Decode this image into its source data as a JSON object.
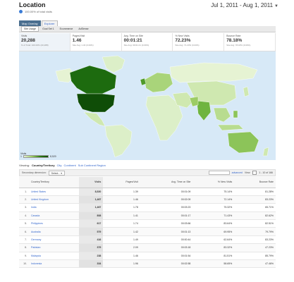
{
  "header": {
    "title": "Location",
    "date_range": "Jul 1, 2011 - Aug 1, 2011",
    "subtitle": "100.00% of total visits"
  },
  "view_tabs": [
    "Map Overlay",
    "Explorer"
  ],
  "sub_tabs": [
    "Site Usage",
    "Goal Set 1",
    "Ecommerce",
    "AdSense"
  ],
  "metrics": [
    {
      "label": "Visits",
      "value": "20,288",
      "sub": "% of Total: 100.00% (20,288)"
    },
    {
      "label": "Pages/Visit",
      "value": "1.46",
      "sub": "Site Avg: 1.46 (0.00%)"
    },
    {
      "label": "Avg. Time on Site",
      "value": "00:01:21",
      "sub": "Site Avg: 00:01:21 (0.00%)"
    },
    {
      "label": "% New Visits",
      "value": "72.23%",
      "sub": "Site Avg: 71.23% (0.00%)"
    },
    {
      "label": "Bounce Rate",
      "value": "78.18%",
      "sub": "Site Avg: 78.18% (0.00%)"
    }
  ],
  "map_legend": {
    "label": "Visits",
    "min": "1",
    "max": "8,520"
  },
  "map_colors": {
    "ocean": "#d7e9f7",
    "low": "#e6f3d3",
    "mid": "#9ccc65",
    "high": "#1d6b0f",
    "top": "#0f4d07"
  },
  "viewing": {
    "prefix": "Viewing:",
    "links": [
      "Country/Territory",
      "City",
      "Continent",
      "Sub Continent Region"
    ]
  },
  "toolbar": {
    "secondary_dimension": "Secondary dimension:",
    "select_label": "Select...",
    "advanced": "advanced",
    "view": "View:",
    "pager": "1 - 10 of 166"
  },
  "table": {
    "headers": [
      "Country/Territory",
      "Visits",
      "Pages/Visit",
      "Avg. Time on Site",
      "% New Visits",
      "Bounce Rate"
    ],
    "rows": [
      {
        "num": "1.",
        "country": "United States",
        "visits": "8,520",
        "ppv": "1.39",
        "time": "00:01:09",
        "new": "75.14%",
        "bounce": "81.28%"
      },
      {
        "num": "2.",
        "country": "United Kingdom",
        "visits": "1,467",
        "ppv": "1.46",
        "time": "00:02:09",
        "new": "72.14%",
        "bounce": "83.23%"
      },
      {
        "num": "3.",
        "country": "India",
        "visits": "1,467",
        "ppv": "1.78",
        "time": "00:03:23",
        "new": "75.32%",
        "bounce": "65.71%"
      },
      {
        "num": "4.",
        "country": "Canada",
        "visits": "808",
        "ppv": "1.41",
        "time": "00:01:17",
        "new": "71.43%",
        "bounce": "82.62%"
      },
      {
        "num": "5.",
        "country": "Philippines",
        "visits": "617",
        "ppv": "1.74",
        "time": "00:03:66",
        "new": "83.64%",
        "bounce": "82.51%"
      },
      {
        "num": "6.",
        "country": "Australia",
        "visits": "579",
        "ppv": "1.42",
        "time": "00:01:13",
        "new": "69.95%",
        "bounce": "79.79%"
      },
      {
        "num": "7.",
        "country": "Germany",
        "visits": "416",
        "ppv": "1.49",
        "time": "00:00:44",
        "new": "62.64%",
        "bounce": "83.23%"
      },
      {
        "num": "8.",
        "country": "Pakistan",
        "visits": "379",
        "ppv": "2.09",
        "time": "00:03:18",
        "new": "83.32%",
        "bounce": "47.23%"
      },
      {
        "num": "9.",
        "country": "Malaysia",
        "visits": "238",
        "ppv": "1.46",
        "time": "00:01:54",
        "new": "81.51%",
        "bounce": "85.79%"
      },
      {
        "num": "10.",
        "country": "Indonesia",
        "visits": "334",
        "ppv": "1.96",
        "time": "00:02:58",
        "new": "58.65%",
        "bounce": "47.46%"
      }
    ]
  }
}
